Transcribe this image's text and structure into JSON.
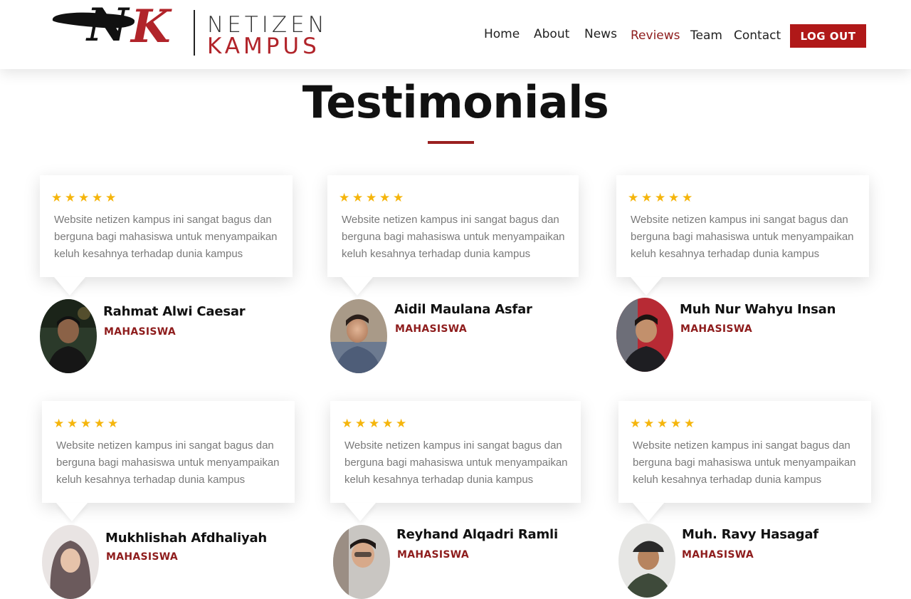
{
  "brand": {
    "monogram_n": "N",
    "monogram_k": "K",
    "word_top": "NETIZEN",
    "word_bottom": "KAMPUS"
  },
  "nav": {
    "items": [
      {
        "label": "Home",
        "active": false
      },
      {
        "label": "About",
        "active": false
      },
      {
        "label": "News",
        "active": false
      },
      {
        "label": "Reviews",
        "active": true
      },
      {
        "label": "Team",
        "active": false
      },
      {
        "label": "Contact",
        "active": false
      }
    ],
    "logout_label": "LOG OUT"
  },
  "section": {
    "title": "Testimonials"
  },
  "testimonials": [
    {
      "rating": 5,
      "quote": "Website netizen kampus ini sangat bagus dan berguna bagi mahasiswa untuk menyampaikan keluh kesahnya terhadap dunia kampus",
      "name": "Rahmat Alwi Caesar",
      "role": "MAHASISWA"
    },
    {
      "rating": 5,
      "quote": "Website netizen kampus ini sangat bagus dan berguna bagi mahasiswa untuk menyampaikan keluh kesahnya terhadap dunia kampus",
      "name": "Aidil Maulana  Asfar",
      "role": "MAHASISWA"
    },
    {
      "rating": 5,
      "quote": "Website netizen kampus ini sangat bagus dan berguna bagi mahasiswa untuk menyampaikan keluh kesahnya terhadap dunia kampus",
      "name": "Muh Nur Wahyu Insan",
      "role": "MAHASISWA"
    },
    {
      "rating": 5,
      "quote": "Website netizen kampus ini sangat bagus dan berguna bagi mahasiswa untuk menyampaikan keluh kesahnya terhadap dunia kampus",
      "name": "Mukhlishah Afdhaliyah",
      "role": "MAHASISWA"
    },
    {
      "rating": 5,
      "quote": "Website netizen kampus ini sangat bagus dan berguna bagi mahasiswa untuk menyampaikan keluh kesahnya terhadap dunia kampus",
      "name": "Reyhand Alqadri Ramli",
      "role": "MAHASISWA"
    },
    {
      "rating": 5,
      "quote": "Website netizen kampus ini sangat bagus dan berguna bagi mahasiswa untuk menyampaikan keluh kesahnya terhadap dunia kampus",
      "name": "Muh. Ravy Hasagaf",
      "role": "MAHASISWA"
    }
  ],
  "colors": {
    "accent": "#b01818",
    "role_text": "#8e1c1c",
    "star": "#f5b50c",
    "quote_text": "#7a7a7a"
  },
  "icons": {
    "star": "star-icon",
    "avatar": "avatar-photo"
  }
}
